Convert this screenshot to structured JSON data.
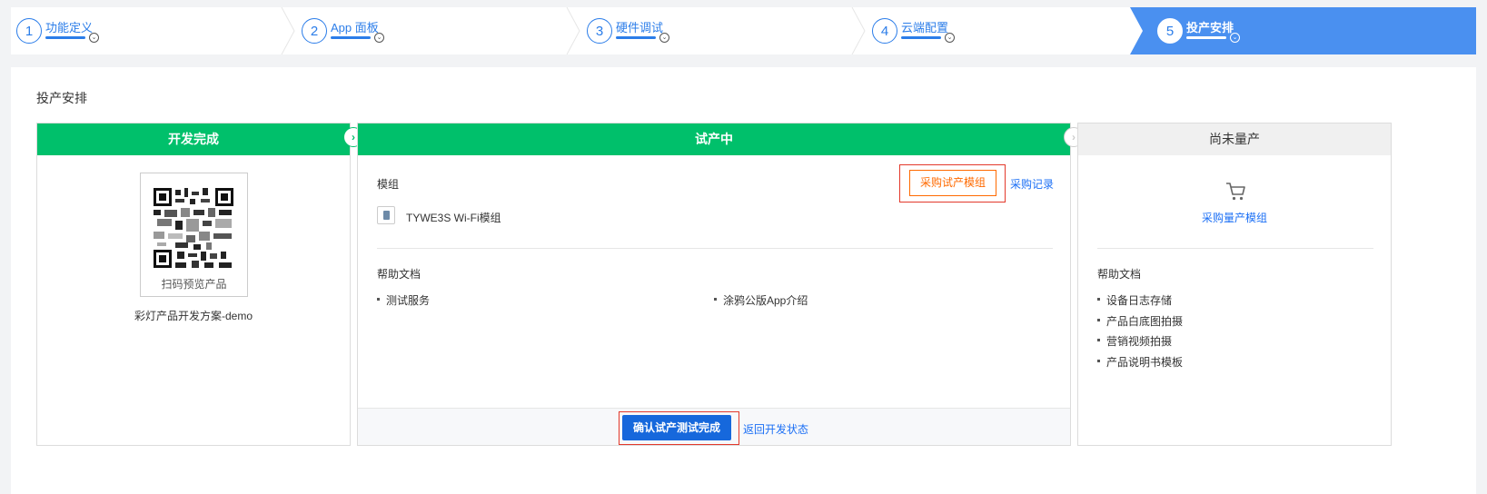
{
  "steps": [
    {
      "num": "1",
      "label": "功能定义"
    },
    {
      "num": "2",
      "label": "App 面板"
    },
    {
      "num": "3",
      "label": "硬件调试"
    },
    {
      "num": "4",
      "label": "云端配置"
    },
    {
      "num": "5",
      "label": "投产安排"
    }
  ],
  "page_title": "投产安排",
  "col_dev": {
    "header": "开发完成",
    "qr_caption": "扫码预览产品",
    "scheme_name": "彩灯产品开发方案-demo"
  },
  "col_trial": {
    "header": "试产中",
    "module_label": "模组",
    "buy_trial_button": "采购试产模组",
    "purchase_record_link": "采购记录",
    "module_name": "TYWE3S Wi-Fi模组",
    "help_label": "帮助文档",
    "help_items": [
      "测试服务",
      "涂鸦公版App介绍"
    ],
    "confirm_button": "确认试产测试完成",
    "back_link": "返回开发状态"
  },
  "col_mass": {
    "header": "尚未量产",
    "buy_mass_link": "采购量产模组",
    "help_label": "帮助文档",
    "help_items": [
      "设备日志存储",
      "产品白底图拍摄",
      "营销视频拍摄",
      "产品说明书模板"
    ]
  },
  "colors": {
    "accent_blue": "#2b7de9",
    "active_step": "#4a90f0",
    "green_header": "#00c06b",
    "orange": "#ff6a00",
    "primary_button": "#1668dc",
    "highlight_red": "#e3392b"
  },
  "icons": [
    "chevron-down-icon",
    "chevron-right-icon",
    "module-chip-icon",
    "cart-icon",
    "qr-code"
  ]
}
